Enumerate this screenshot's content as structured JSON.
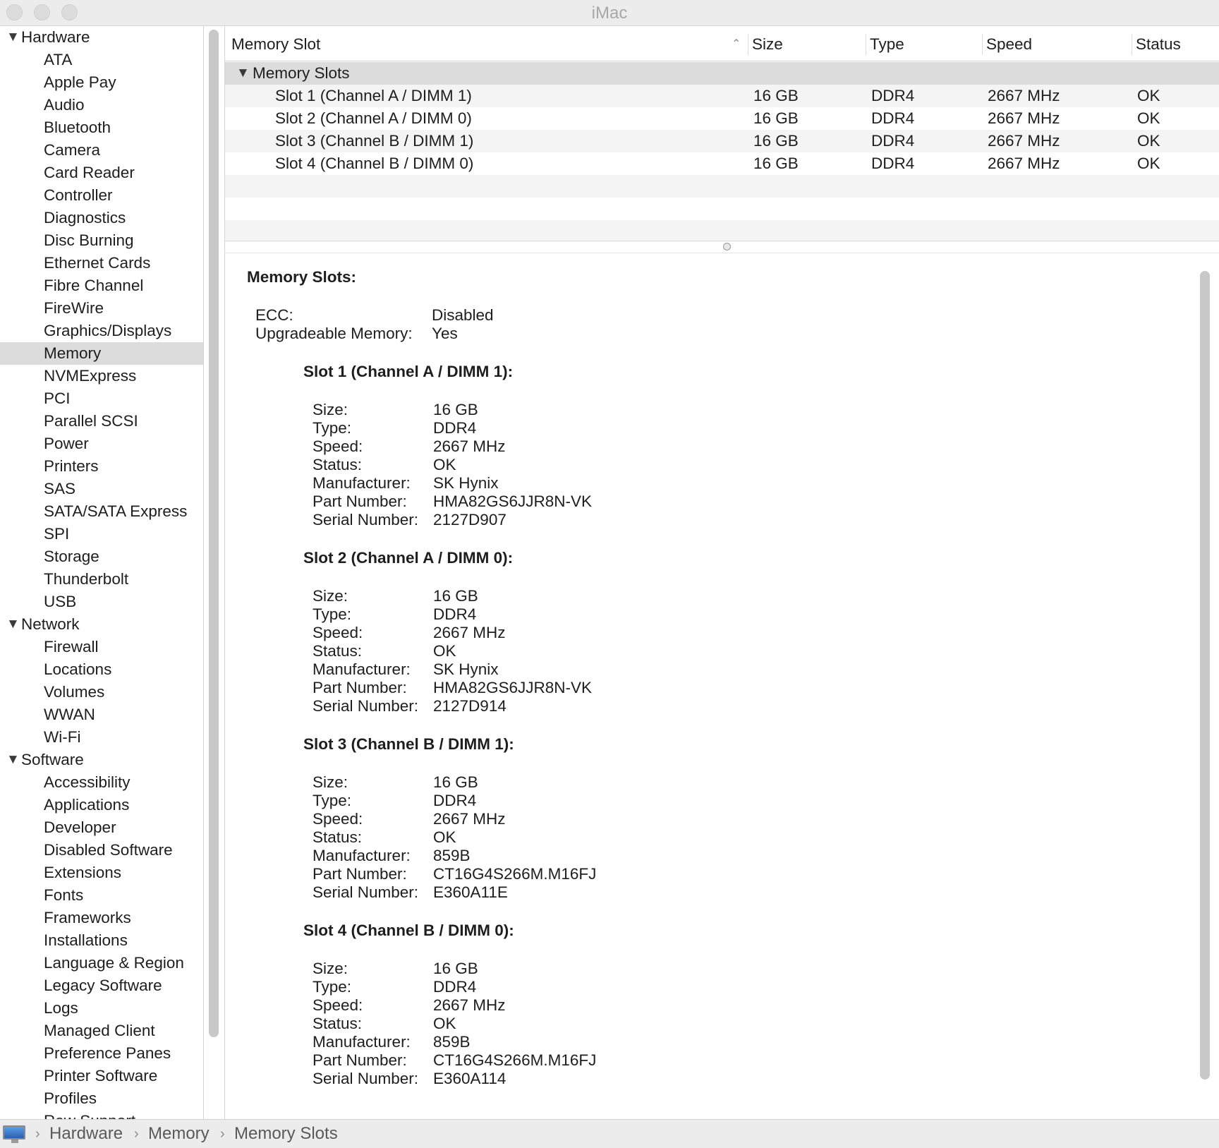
{
  "window": {
    "title": "iMac"
  },
  "sidebar": {
    "groups": [
      {
        "label": "Hardware",
        "items": [
          "ATA",
          "Apple Pay",
          "Audio",
          "Bluetooth",
          "Camera",
          "Card Reader",
          "Controller",
          "Diagnostics",
          "Disc Burning",
          "Ethernet Cards",
          "Fibre Channel",
          "FireWire",
          "Graphics/Displays",
          "Memory",
          "NVMExpress",
          "PCI",
          "Parallel SCSI",
          "Power",
          "Printers",
          "SAS",
          "SATA/SATA Express",
          "SPI",
          "Storage",
          "Thunderbolt",
          "USB"
        ]
      },
      {
        "label": "Network",
        "items": [
          "Firewall",
          "Locations",
          "Volumes",
          "WWAN",
          "Wi-Fi"
        ]
      },
      {
        "label": "Software",
        "items": [
          "Accessibility",
          "Applications",
          "Developer",
          "Disabled Software",
          "Extensions",
          "Fonts",
          "Frameworks",
          "Installations",
          "Language & Region",
          "Legacy Software",
          "Logs",
          "Managed Client",
          "Preference Panes",
          "Printer Software",
          "Profiles",
          "Raw Support"
        ]
      }
    ],
    "selected": "Memory"
  },
  "table": {
    "columns": [
      "Memory Slot",
      "Size",
      "Type",
      "Speed",
      "Status"
    ],
    "group_label": "Memory Slots",
    "rows": [
      [
        "Slot 1 (Channel A / DIMM 1)",
        "16 GB",
        "DDR4",
        "2667 MHz",
        "OK"
      ],
      [
        "Slot 2 (Channel A / DIMM 0)",
        "16 GB",
        "DDR4",
        "2667 MHz",
        "OK"
      ],
      [
        "Slot 3 (Channel B / DIMM 1)",
        "16 GB",
        "DDR4",
        "2667 MHz",
        "OK"
      ],
      [
        "Slot 4 (Channel B / DIMM 0)",
        "16 GB",
        "DDR4",
        "2667 MHz",
        "OK"
      ]
    ]
  },
  "detail": {
    "title": "Memory Slots:",
    "summary": [
      {
        "key": "ECC:",
        "value": "Disabled"
      },
      {
        "key": "Upgradeable Memory:",
        "value": "Yes"
      }
    ],
    "slots": [
      {
        "title": "Slot 1 (Channel A / DIMM 1):",
        "fields": [
          {
            "key": "Size:",
            "value": "16 GB"
          },
          {
            "key": "Type:",
            "value": "DDR4"
          },
          {
            "key": "Speed:",
            "value": "2667 MHz"
          },
          {
            "key": "Status:",
            "value": "OK"
          },
          {
            "key": "Manufacturer:",
            "value": "SK Hynix"
          },
          {
            "key": "Part Number:",
            "value": "HMA82GS6JJR8N-VK"
          },
          {
            "key": "Serial Number:",
            "value": "2127D907"
          }
        ]
      },
      {
        "title": "Slot 2 (Channel A / DIMM 0):",
        "fields": [
          {
            "key": "Size:",
            "value": "16 GB"
          },
          {
            "key": "Type:",
            "value": "DDR4"
          },
          {
            "key": "Speed:",
            "value": "2667 MHz"
          },
          {
            "key": "Status:",
            "value": "OK"
          },
          {
            "key": "Manufacturer:",
            "value": "SK Hynix"
          },
          {
            "key": "Part Number:",
            "value": "HMA82GS6JJR8N-VK"
          },
          {
            "key": "Serial Number:",
            "value": "2127D914"
          }
        ]
      },
      {
        "title": "Slot 3 (Channel B / DIMM 1):",
        "fields": [
          {
            "key": "Size:",
            "value": "16 GB"
          },
          {
            "key": "Type:",
            "value": "DDR4"
          },
          {
            "key": "Speed:",
            "value": "2667 MHz"
          },
          {
            "key": "Status:",
            "value": "OK"
          },
          {
            "key": "Manufacturer:",
            "value": "859B"
          },
          {
            "key": "Part Number:",
            "value": "CT16G4S266M.M16FJ"
          },
          {
            "key": "Serial Number:",
            "value": "E360A11E"
          }
        ]
      },
      {
        "title": "Slot 4 (Channel B / DIMM 0):",
        "fields": [
          {
            "key": "Size:",
            "value": "16 GB"
          },
          {
            "key": "Type:",
            "value": "DDR4"
          },
          {
            "key": "Speed:",
            "value": "2667 MHz"
          },
          {
            "key": "Status:",
            "value": "OK"
          },
          {
            "key": "Manufacturer:",
            "value": "859B"
          },
          {
            "key": "Part Number:",
            "value": "CT16G4S266M.M16FJ"
          },
          {
            "key": "Serial Number:",
            "value": "E360A114"
          }
        ]
      }
    ]
  },
  "breadcrumb": [
    "Hardware",
    "Memory",
    "Memory Slots"
  ],
  "icons": {
    "computer": "imac-icon",
    "disclosure": "disclosure-triangle-icon",
    "sort": "sort-ascending-icon",
    "separator": "chevron-right-icon"
  },
  "colors": {
    "selection": "#dcdcdc",
    "titlebar": "#ececec"
  }
}
